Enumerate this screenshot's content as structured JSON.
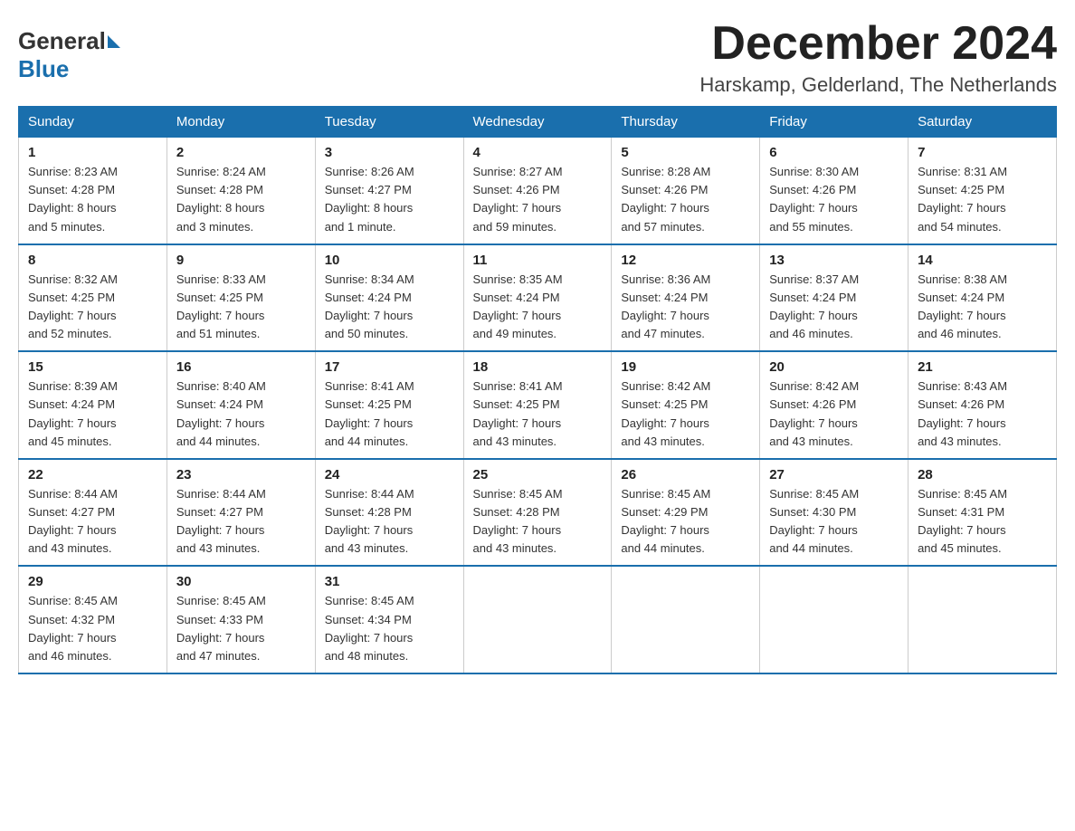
{
  "logo": {
    "general": "General",
    "blue": "Blue"
  },
  "title": "December 2024",
  "location": "Harskamp, Gelderland, The Netherlands",
  "weekdays": [
    "Sunday",
    "Monday",
    "Tuesday",
    "Wednesday",
    "Thursday",
    "Friday",
    "Saturday"
  ],
  "weeks": [
    [
      {
        "day": "1",
        "sunrise": "8:23 AM",
        "sunset": "4:28 PM",
        "daylight": "8 hours and 5 minutes."
      },
      {
        "day": "2",
        "sunrise": "8:24 AM",
        "sunset": "4:28 PM",
        "daylight": "8 hours and 3 minutes."
      },
      {
        "day": "3",
        "sunrise": "8:26 AM",
        "sunset": "4:27 PM",
        "daylight": "8 hours and 1 minute."
      },
      {
        "day": "4",
        "sunrise": "8:27 AM",
        "sunset": "4:26 PM",
        "daylight": "7 hours and 59 minutes."
      },
      {
        "day": "5",
        "sunrise": "8:28 AM",
        "sunset": "4:26 PM",
        "daylight": "7 hours and 57 minutes."
      },
      {
        "day": "6",
        "sunrise": "8:30 AM",
        "sunset": "4:26 PM",
        "daylight": "7 hours and 55 minutes."
      },
      {
        "day": "7",
        "sunrise": "8:31 AM",
        "sunset": "4:25 PM",
        "daylight": "7 hours and 54 minutes."
      }
    ],
    [
      {
        "day": "8",
        "sunrise": "8:32 AM",
        "sunset": "4:25 PM",
        "daylight": "7 hours and 52 minutes."
      },
      {
        "day": "9",
        "sunrise": "8:33 AM",
        "sunset": "4:25 PM",
        "daylight": "7 hours and 51 minutes."
      },
      {
        "day": "10",
        "sunrise": "8:34 AM",
        "sunset": "4:24 PM",
        "daylight": "7 hours and 50 minutes."
      },
      {
        "day": "11",
        "sunrise": "8:35 AM",
        "sunset": "4:24 PM",
        "daylight": "7 hours and 49 minutes."
      },
      {
        "day": "12",
        "sunrise": "8:36 AM",
        "sunset": "4:24 PM",
        "daylight": "7 hours and 47 minutes."
      },
      {
        "day": "13",
        "sunrise": "8:37 AM",
        "sunset": "4:24 PM",
        "daylight": "7 hours and 46 minutes."
      },
      {
        "day": "14",
        "sunrise": "8:38 AM",
        "sunset": "4:24 PM",
        "daylight": "7 hours and 46 minutes."
      }
    ],
    [
      {
        "day": "15",
        "sunrise": "8:39 AM",
        "sunset": "4:24 PM",
        "daylight": "7 hours and 45 minutes."
      },
      {
        "day": "16",
        "sunrise": "8:40 AM",
        "sunset": "4:24 PM",
        "daylight": "7 hours and 44 minutes."
      },
      {
        "day": "17",
        "sunrise": "8:41 AM",
        "sunset": "4:25 PM",
        "daylight": "7 hours and 44 minutes."
      },
      {
        "day": "18",
        "sunrise": "8:41 AM",
        "sunset": "4:25 PM",
        "daylight": "7 hours and 43 minutes."
      },
      {
        "day": "19",
        "sunrise": "8:42 AM",
        "sunset": "4:25 PM",
        "daylight": "7 hours and 43 minutes."
      },
      {
        "day": "20",
        "sunrise": "8:42 AM",
        "sunset": "4:26 PM",
        "daylight": "7 hours and 43 minutes."
      },
      {
        "day": "21",
        "sunrise": "8:43 AM",
        "sunset": "4:26 PM",
        "daylight": "7 hours and 43 minutes."
      }
    ],
    [
      {
        "day": "22",
        "sunrise": "8:44 AM",
        "sunset": "4:27 PM",
        "daylight": "7 hours and 43 minutes."
      },
      {
        "day": "23",
        "sunrise": "8:44 AM",
        "sunset": "4:27 PM",
        "daylight": "7 hours and 43 minutes."
      },
      {
        "day": "24",
        "sunrise": "8:44 AM",
        "sunset": "4:28 PM",
        "daylight": "7 hours and 43 minutes."
      },
      {
        "day": "25",
        "sunrise": "8:45 AM",
        "sunset": "4:28 PM",
        "daylight": "7 hours and 43 minutes."
      },
      {
        "day": "26",
        "sunrise": "8:45 AM",
        "sunset": "4:29 PM",
        "daylight": "7 hours and 44 minutes."
      },
      {
        "day": "27",
        "sunrise": "8:45 AM",
        "sunset": "4:30 PM",
        "daylight": "7 hours and 44 minutes."
      },
      {
        "day": "28",
        "sunrise": "8:45 AM",
        "sunset": "4:31 PM",
        "daylight": "7 hours and 45 minutes."
      }
    ],
    [
      {
        "day": "29",
        "sunrise": "8:45 AM",
        "sunset": "4:32 PM",
        "daylight": "7 hours and 46 minutes."
      },
      {
        "day": "30",
        "sunrise": "8:45 AM",
        "sunset": "4:33 PM",
        "daylight": "7 hours and 47 minutes."
      },
      {
        "day": "31",
        "sunrise": "8:45 AM",
        "sunset": "4:34 PM",
        "daylight": "7 hours and 48 minutes."
      },
      null,
      null,
      null,
      null
    ]
  ],
  "labels": {
    "sunrise": "Sunrise:",
    "sunset": "Sunset:",
    "daylight": "Daylight:"
  }
}
